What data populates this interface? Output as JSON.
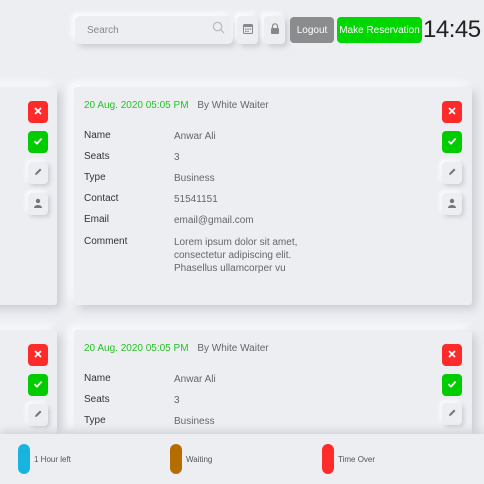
{
  "toolbar": {
    "search_placeholder": "Search",
    "logout_label": "Logout",
    "make_reservation_label": "Make Reservation",
    "clock": "14:45"
  },
  "labels": {
    "name": "Name",
    "seats": "Seats",
    "type": "Type",
    "contact": "Contact",
    "email": "Email",
    "comment": "Comment"
  },
  "reservations": [
    {
      "date": "20 Aug. 2020 05:05 PM",
      "waiter": "By White Waiter",
      "name": "Anwar Ali",
      "seats": "3",
      "type": "Business",
      "contact": "51541151",
      "email": "email@gmail.com",
      "comment": "Lorem ipsum dolor sit amet, consectetur adipiscing elit. Phasellus ullamcorper vu"
    },
    {
      "date": "20 Aug. 2020 05:05 PM",
      "waiter": "By White Waiter",
      "name": "Anwar Ali",
      "seats": "3",
      "type": "Business"
    }
  ],
  "legend": [
    {
      "label": "1 Hour left",
      "color": "#18b4e0"
    },
    {
      "label": "Waiting",
      "color": "#b46e00"
    },
    {
      "label": "Time Over",
      "color": "#ff2a2a"
    }
  ],
  "colors": {
    "accent_green": "#00d600",
    "reject_red": "#ff2a2a",
    "date_green": "#24c324",
    "logout_gray": "#8b8c8e",
    "background": "#eceef2"
  },
  "icons": [
    "search-icon",
    "calendar-icon",
    "lock-icon",
    "close-icon",
    "check-icon",
    "pencil-icon",
    "user-icon"
  ]
}
